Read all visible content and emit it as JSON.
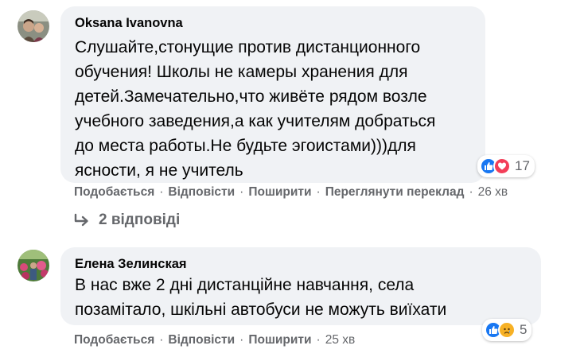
{
  "comments": [
    {
      "author": "Oksana Ivanovna",
      "lines": [
        "Слушайте,стонущие против дистанционного",
        "обучения! Школы не камеры хранения для",
        "детей.Замечательно,что живёте рядом возле",
        "учебного заведения,а как учителям добраться",
        "до места работы.Не будьте эгоистами)))для",
        "ясности, я не учитель"
      ],
      "reaction_count": "17",
      "reaction_icons": [
        "like-icon",
        "love-icon"
      ],
      "actions": {
        "like": "Подобається",
        "reply": "Відповісти",
        "share": "Поширити",
        "translate": "Переглянути переклад",
        "time": "26 хв"
      },
      "replies_label": "2 відповіді"
    },
    {
      "author": "Елена Зелинская",
      "lines": [
        "В нас вже 2 дні дистанційне навчання, села",
        "позамітало, шкільні автобуси не можуть виїхати"
      ],
      "reaction_count": "5",
      "reaction_icons": [
        "like-icon",
        "sad-icon"
      ],
      "actions": {
        "like": "Подобається",
        "reply": "Відповісти",
        "share": "Поширити",
        "time": "25 хв"
      }
    }
  ],
  "colors": {
    "bubble": "#f0f2f5",
    "secondary_text": "#65676b",
    "like_blue": "#1877f2",
    "love_red": "#f33e58",
    "sad_yellow": "#f7b125"
  }
}
